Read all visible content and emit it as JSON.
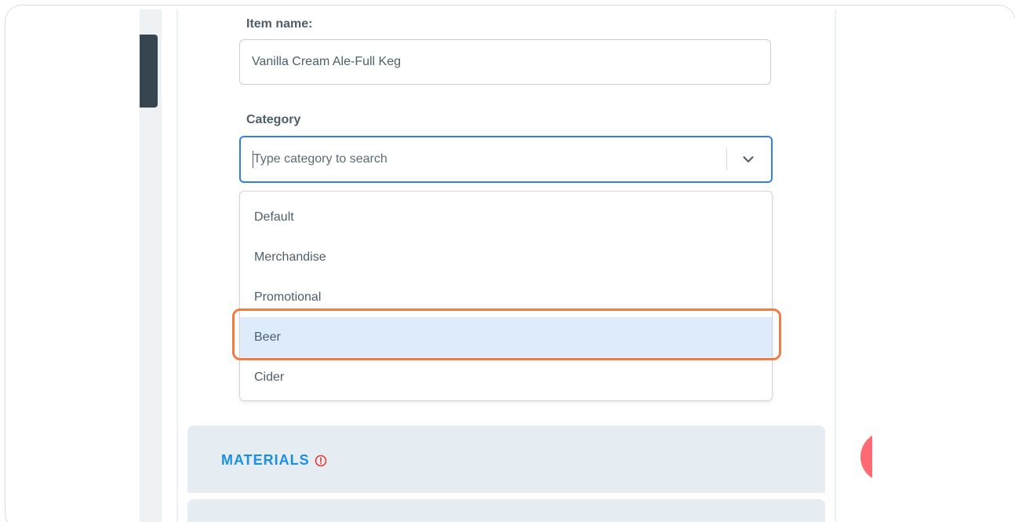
{
  "form": {
    "item_name": {
      "label": "Item name:",
      "value": "Vanilla Cream Ale-Full Keg"
    },
    "category": {
      "label": "Category",
      "placeholder": "Type category to search",
      "options": [
        "Default",
        "Merchandise",
        "Promotional",
        "Beer",
        "Cider"
      ],
      "highlighted_option": "Beer"
    }
  },
  "sections": {
    "materials": {
      "title": "MATERIALS",
      "status_icon": "warning-circle-icon"
    }
  },
  "colors": {
    "accent": "#2f80ed",
    "section_title": "#1a8fe3",
    "warning": "#e53935",
    "highlight_outline": "#f07c44",
    "fab": "#ff6a72"
  }
}
